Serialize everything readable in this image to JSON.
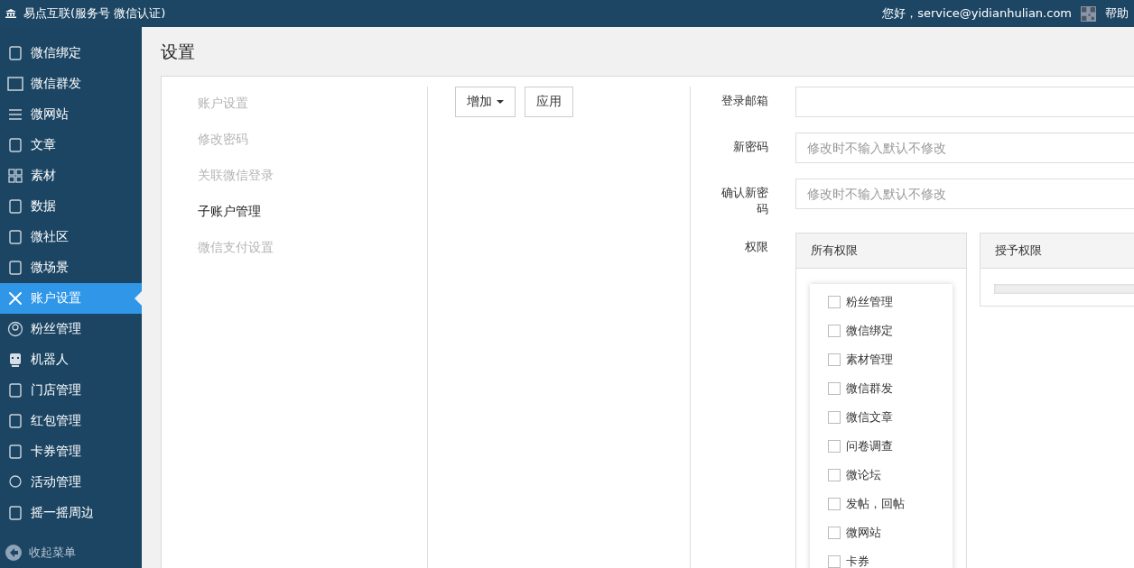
{
  "topbar": {
    "brand": "易点互联(服务号 微信认证)",
    "greeting": "您好，service@yidianhulian.com",
    "help": "帮助"
  },
  "sidebar": {
    "items": [
      {
        "label": "微信绑定",
        "selected": false
      },
      {
        "label": "微信群发",
        "selected": false
      },
      {
        "label": "微网站",
        "selected": false
      },
      {
        "label": "文章",
        "selected": false
      },
      {
        "label": "素材",
        "selected": false
      },
      {
        "label": "数据",
        "selected": false
      },
      {
        "label": "微社区",
        "selected": false
      },
      {
        "label": "微场景",
        "selected": false
      },
      {
        "label": "账户设置",
        "selected": true
      },
      {
        "label": "粉丝管理",
        "selected": false
      },
      {
        "label": "机器人",
        "selected": false
      },
      {
        "label": "门店管理",
        "selected": false
      },
      {
        "label": "红包管理",
        "selected": false
      },
      {
        "label": "卡券管理",
        "selected": false
      },
      {
        "label": "活动管理",
        "selected": false
      },
      {
        "label": "摇一摇周边",
        "selected": false
      }
    ],
    "collapse": "收起菜单"
  },
  "page_title": "设置",
  "settings_nav": [
    {
      "label": "账户设置",
      "selected": false
    },
    {
      "label": "修改密码",
      "selected": false
    },
    {
      "label": "关联微信登录",
      "selected": false
    },
    {
      "label": "子账户管理",
      "selected": true
    },
    {
      "label": "微信支付设置",
      "selected": false
    }
  ],
  "toolbar": {
    "add": "增加",
    "apply": "应用"
  },
  "form": {
    "fields": [
      {
        "label": "登录邮箱"
      },
      {
        "label": "新密码",
        "placeholder": "修改时不输入默认不修改"
      },
      {
        "label": "确认新密码",
        "placeholder": "修改时不输入默认不修改"
      }
    ],
    "permissions_label": "权限",
    "all_panel": {
      "title": "所有权限",
      "items": [
        {
          "label": "粉丝管理",
          "checked": false
        },
        {
          "label": "微信绑定",
          "checked": false
        },
        {
          "label": "素材管理",
          "checked": false
        },
        {
          "label": "微信群发",
          "checked": false
        },
        {
          "label": "微信文章",
          "checked": false
        },
        {
          "label": "问卷调查",
          "checked": false
        },
        {
          "label": "微论坛",
          "checked": false
        },
        {
          "label": "发帖，回帖",
          "checked": false
        },
        {
          "label": "微网站",
          "checked": false
        },
        {
          "label": "卡券",
          "checked": false
        }
      ]
    },
    "granted_panel": {
      "title": "授予权限"
    }
  }
}
